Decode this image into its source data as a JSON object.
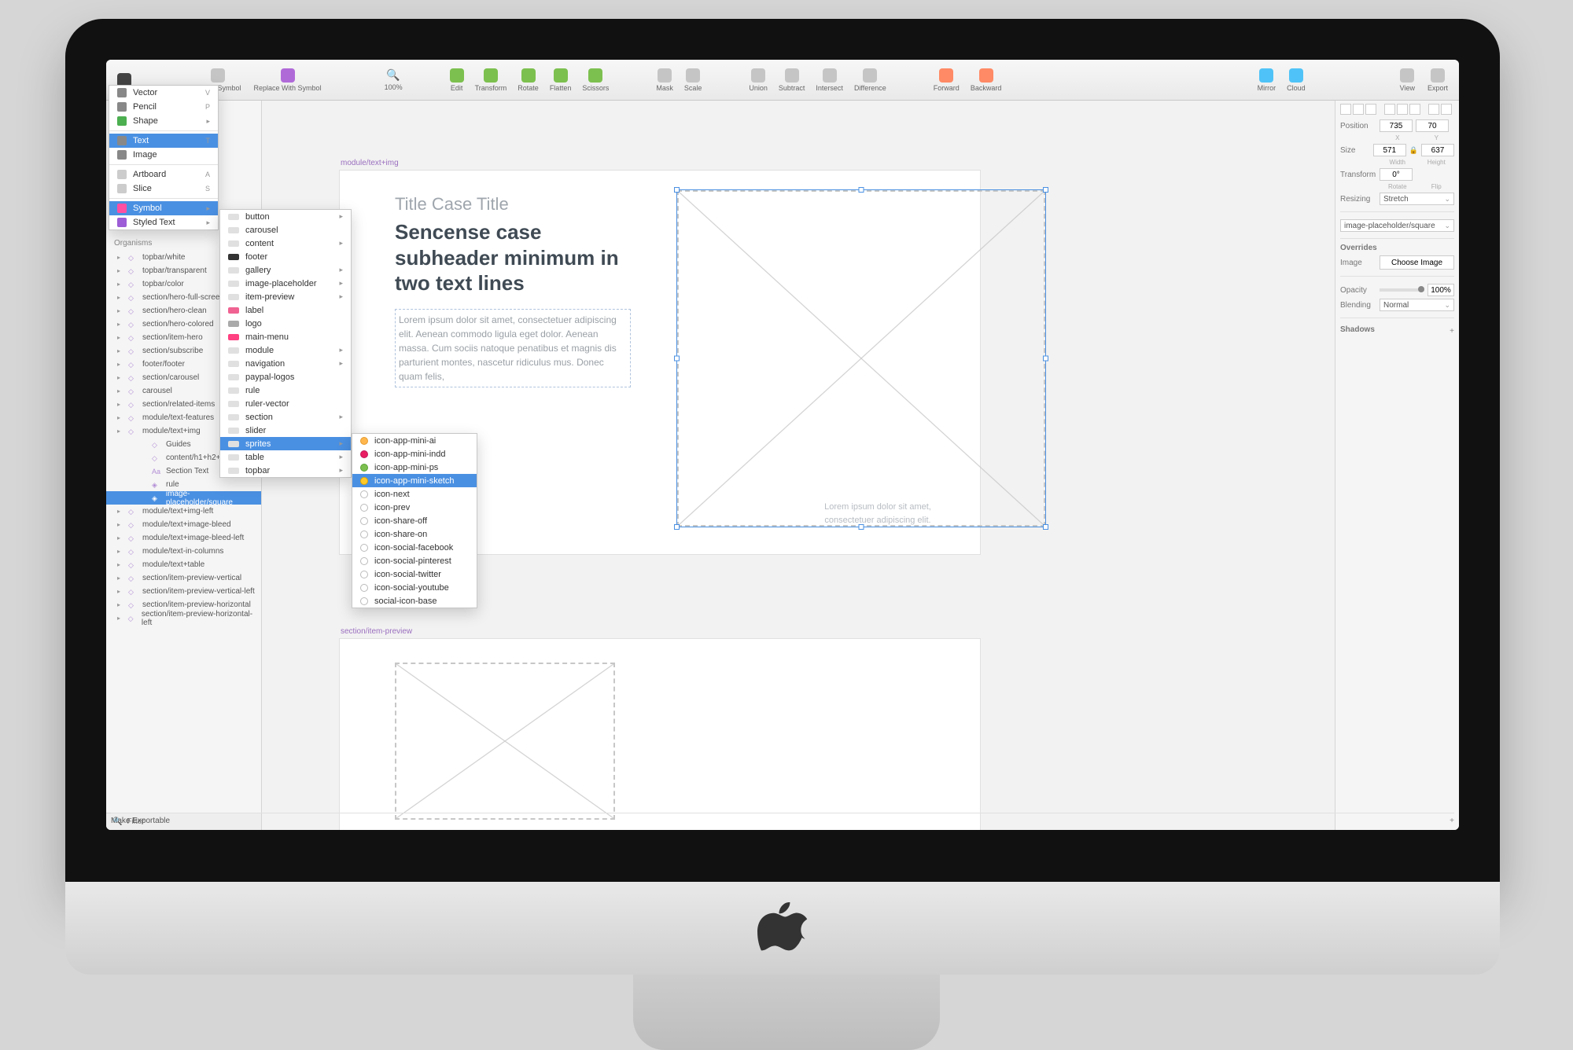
{
  "toolbar": {
    "insert_shapes": "",
    "create_symbol": "Create Symbol",
    "replace_symbol": "Replace With Symbol",
    "zoom_value": "100%",
    "edit": "Edit",
    "transform": "Transform",
    "rotate": "Rotate",
    "flatten": "Flatten",
    "scissors": "Scissors",
    "mask": "Mask",
    "scale": "Scale",
    "union": "Union",
    "subtract": "Subtract",
    "intersect": "Intersect",
    "difference": "Difference",
    "forward": "Forward",
    "backward": "Backward",
    "mirror": "Mirror",
    "cloud": "Cloud",
    "view": "View",
    "export": "Export"
  },
  "insert_menu": [
    {
      "label": "Vector",
      "shortcut": "V",
      "color": "#888"
    },
    {
      "label": "Pencil",
      "shortcut": "P",
      "color": "#888"
    },
    {
      "label": "Shape",
      "shortcut": "▸",
      "color": "#4caf50"
    },
    {
      "sep": true
    },
    {
      "label": "Text",
      "shortcut": "T",
      "color": "#888",
      "active": true
    },
    {
      "label": "Image",
      "shortcut": "",
      "color": "#888"
    },
    {
      "sep": true
    },
    {
      "label": "Artboard",
      "shortcut": "A",
      "color": "#ccc"
    },
    {
      "label": "Slice",
      "shortcut": "S",
      "color": "#ccc"
    },
    {
      "sep": true
    },
    {
      "label": "Symbol",
      "shortcut": "▸",
      "color": "#ff4fa3",
      "active": true
    },
    {
      "label": "Styled Text",
      "shortcut": "▸",
      "color": "#9c5dd6"
    }
  ],
  "symbol_menu": [
    {
      "label": "button",
      "arrow": true,
      "sw": "#e0e0e0"
    },
    {
      "label": "carousel",
      "sw": "#e0e0e0"
    },
    {
      "label": "content",
      "arrow": true,
      "sw": "#e0e0e0"
    },
    {
      "label": "footer",
      "sw": "#333"
    },
    {
      "label": "gallery",
      "arrow": true,
      "sw": "#e0e0e0"
    },
    {
      "label": "image-placeholder",
      "arrow": true,
      "sw": "#e0e0e0"
    },
    {
      "label": "item-preview",
      "arrow": true,
      "sw": "#e0e0e0"
    },
    {
      "label": "label",
      "sw": "#f06292"
    },
    {
      "label": "logo",
      "sw": "#aaa"
    },
    {
      "label": "main-menu",
      "sw": "#ff4081"
    },
    {
      "label": "module",
      "arrow": true,
      "sw": "#e0e0e0"
    },
    {
      "label": "navigation",
      "arrow": true,
      "sw": "#e0e0e0"
    },
    {
      "label": "paypal-logos",
      "sw": "#e0e0e0"
    },
    {
      "label": "rule",
      "sw": "#e0e0e0"
    },
    {
      "label": "ruler-vector",
      "sw": "#e0e0e0"
    },
    {
      "label": "section",
      "arrow": true,
      "sw": "#e0e0e0"
    },
    {
      "label": "slider",
      "sw": "#e0e0e0"
    },
    {
      "label": "sprites",
      "arrow": true,
      "active": true,
      "sw": "#e0e0e0"
    },
    {
      "label": "table",
      "arrow": true,
      "sw": "#e0e0e0"
    },
    {
      "label": "topbar",
      "arrow": true,
      "sw": "#e0e0e0"
    }
  ],
  "sprites_menu": [
    {
      "label": "icon-app-mini-ai",
      "dot": "o"
    },
    {
      "label": "icon-app-mini-indd",
      "dot": "m"
    },
    {
      "label": "icon-app-mini-ps",
      "dot": "p"
    },
    {
      "label": "icon-app-mini-sketch",
      "dot": "s",
      "active": true
    },
    {
      "label": "icon-next",
      "dot": ""
    },
    {
      "label": "icon-prev",
      "dot": ""
    },
    {
      "label": "icon-share-off",
      "dot": ""
    },
    {
      "label": "icon-share-on",
      "dot": ""
    },
    {
      "label": "icon-social-facebook",
      "dot": ""
    },
    {
      "label": "icon-social-pinterest",
      "dot": ""
    },
    {
      "label": "icon-social-twitter",
      "dot": ""
    },
    {
      "label": "icon-social-youtube",
      "dot": ""
    },
    {
      "label": "social-icon-base",
      "dot": ""
    }
  ],
  "layers": {
    "header": "Organisms",
    "items": [
      {
        "label": "topbar/white"
      },
      {
        "label": "topbar/transparent"
      },
      {
        "label": "topbar/color"
      },
      {
        "label": "section/hero-full-screen"
      },
      {
        "label": "section/hero-clean"
      },
      {
        "label": "section/hero-colored"
      },
      {
        "label": "section/item-hero"
      },
      {
        "label": "section/subscribe"
      },
      {
        "label": "footer/footer"
      },
      {
        "label": "section/carousel"
      },
      {
        "label": "carousel"
      },
      {
        "label": "section/related-items"
      },
      {
        "label": "module/text-features"
      },
      {
        "label": "module/text+img",
        "expanded": true,
        "children": [
          {
            "label": "Guides"
          },
          {
            "label": "content/h1+h2+descrip"
          },
          {
            "label": "Section Text",
            "type": "text"
          },
          {
            "label": "rule",
            "type": "sym"
          },
          {
            "label": "image-placeholder/square",
            "sel": true,
            "type": "sym"
          }
        ]
      },
      {
        "label": "module/text+img-left"
      },
      {
        "label": "module/text+image-bleed"
      },
      {
        "label": "module/text+image-bleed-left"
      },
      {
        "label": "module/text-in-columns"
      },
      {
        "label": "module/text+table"
      },
      {
        "label": "section/item-preview-vertical"
      },
      {
        "label": "section/item-preview-vertical-left"
      },
      {
        "label": "section/item-preview-horizontal"
      },
      {
        "label": "section/item-preview-horizontal-left"
      }
    ],
    "filter_placeholder": "Filter"
  },
  "canvas": {
    "artboard1_label": "module/text+img",
    "artboard2_label": "section/item-preview",
    "title": "Title Case Title",
    "subheader": "Sencense case subheader minimum in two text lines",
    "body": "Lorem ipsum dolor sit amet, consectetuer adipiscing elit. Aenean commodo ligula eget dolor. Aenean massa. Cum sociis natoque penatibus et magnis dis parturient montes, nascetur ridiculus mus. Donec quam felis,",
    "caption": "Lorem ipsum dolor sit amet, consectetuer adipiscing elit."
  },
  "inspector": {
    "position_label": "Position",
    "pos_x": "735",
    "pos_y": "70",
    "pos_x_sub": "X",
    "pos_y_sub": "Y",
    "size_label": "Size",
    "size_w": "571",
    "size_h": "637",
    "size_w_sub": "Width",
    "size_h_sub": "Height",
    "transform_label": "Transform",
    "rotate_val": "0°",
    "rotate_sub": "Rotate",
    "flip_sub": "Flip",
    "resizing_label": "Resizing",
    "resizing_value": "Stretch",
    "symbol_select": "image-placeholder/square",
    "overrides_label": "Overrides",
    "image_label": "Image",
    "choose_image": "Choose Image",
    "opacity_label": "Opacity",
    "opacity_value": "100%",
    "blending_label": "Blending",
    "blending_value": "Normal",
    "shadows_label": "Shadows",
    "make_exportable": "Make Exportable"
  }
}
